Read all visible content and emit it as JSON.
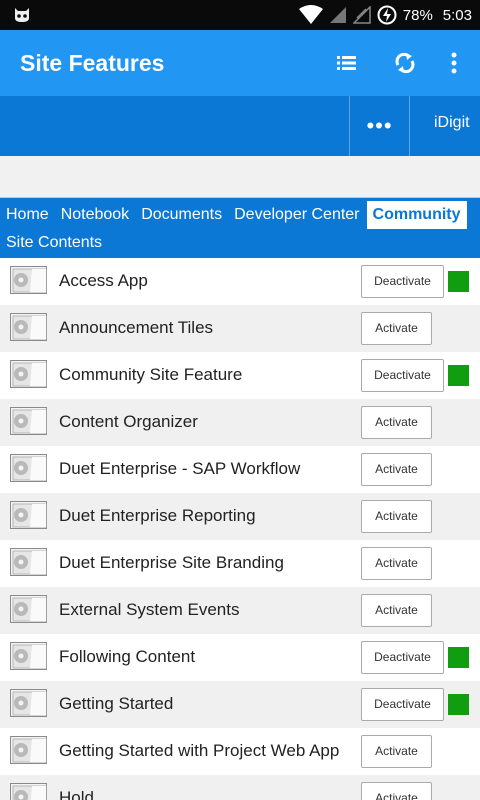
{
  "status_bar": {
    "battery": "78%",
    "time": "5:03",
    "icons": [
      "android-debug-icon",
      "wifi-icon",
      "signal-icon",
      "signal-empty-icon",
      "battery-charging-icon"
    ]
  },
  "app_bar": {
    "title": "Site Features",
    "actions": [
      "list-icon",
      "refresh-icon",
      "more-vert-icon"
    ],
    "color": "#2196f3"
  },
  "site_band": {
    "more_label": "•••",
    "site_label": "iDigit",
    "color": "#0a78d4"
  },
  "nav": {
    "tabs": [
      {
        "label": "Home"
      },
      {
        "label": "Notebook"
      },
      {
        "label": "Documents"
      },
      {
        "label": "Developer Center"
      },
      {
        "label": "Community",
        "active": true
      }
    ],
    "secondary": "Site Contents"
  },
  "features": [
    {
      "name": "Access App",
      "action": "Deactivate",
      "active": true
    },
    {
      "name": "Announcement Tiles",
      "action": "Activate",
      "active": false
    },
    {
      "name": "Community Site Feature",
      "action": "Deactivate",
      "active": true
    },
    {
      "name": "Content Organizer",
      "action": "Activate",
      "active": false
    },
    {
      "name": "Duet Enterprise - SAP Workflow",
      "action": "Activate",
      "active": false
    },
    {
      "name": "Duet Enterprise Reporting",
      "action": "Activate",
      "active": false
    },
    {
      "name": "Duet Enterprise Site Branding",
      "action": "Activate",
      "active": false
    },
    {
      "name": "External System Events",
      "action": "Activate",
      "active": false
    },
    {
      "name": "Following Content",
      "action": "Deactivate",
      "active": true
    },
    {
      "name": "Getting Started",
      "action": "Deactivate",
      "active": true
    },
    {
      "name": "Getting Started with Project Web App",
      "action": "Activate",
      "active": false
    },
    {
      "name": "Hold",
      "action": "Activate",
      "active": false
    }
  ],
  "colors": {
    "active_indicator": "#109e10",
    "row_alt": "#f0f0f0"
  }
}
